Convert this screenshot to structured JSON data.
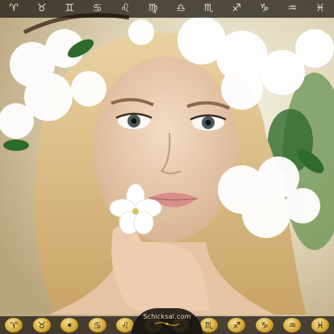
{
  "top_bar": {
    "zodiac_signs": [
      {
        "glyph": "♈",
        "icon": "aries-icon"
      },
      {
        "glyph": "♉",
        "icon": "taurus-icon"
      },
      {
        "glyph": "♊",
        "icon": "gemini-icon"
      },
      {
        "glyph": "♋",
        "icon": "cancer-icon"
      },
      {
        "glyph": "♌",
        "icon": "leo-icon"
      },
      {
        "glyph": "♍",
        "icon": "virgo-icon"
      },
      {
        "glyph": "♎",
        "icon": "libra-icon"
      },
      {
        "glyph": "♏",
        "icon": "scorpio-icon"
      },
      {
        "glyph": "♐",
        "icon": "sagittarius-icon"
      },
      {
        "glyph": "♑",
        "icon": "capricorn-icon"
      },
      {
        "glyph": "♒",
        "icon": "aquarius-icon"
      },
      {
        "glyph": "♓",
        "icon": "pisces-icon"
      }
    ]
  },
  "bottom_bar": {
    "symbols": [
      {
        "glyph": "♈",
        "icon": "gold-ram-icon"
      },
      {
        "glyph": "♉",
        "icon": "gold-bull-icon"
      },
      {
        "glyph": "✶",
        "icon": "gold-butterfly-icon"
      },
      {
        "glyph": "♋",
        "icon": "gold-crab-icon"
      },
      {
        "glyph": "♌",
        "icon": "gold-lion-icon"
      },
      {
        "glyph": "♍",
        "icon": "gold-virgo-icon"
      },
      {
        "glyph": "♎",
        "icon": "gold-scales-icon"
      },
      {
        "glyph": "♏",
        "icon": "gold-scorpion-icon"
      },
      {
        "glyph": "♐",
        "icon": "gold-archer-icon"
      },
      {
        "glyph": "♑",
        "icon": "gold-goat-icon"
      },
      {
        "glyph": "♒",
        "icon": "gold-waterbearer-icon"
      },
      {
        "glyph": "♓",
        "icon": "gold-fish-icon"
      }
    ]
  },
  "logo": {
    "text": "Schicksal.com"
  },
  "colors": {
    "bar_bg": "#16120e",
    "gold": "#d4a531",
    "glyph": "#e8e0d0"
  }
}
